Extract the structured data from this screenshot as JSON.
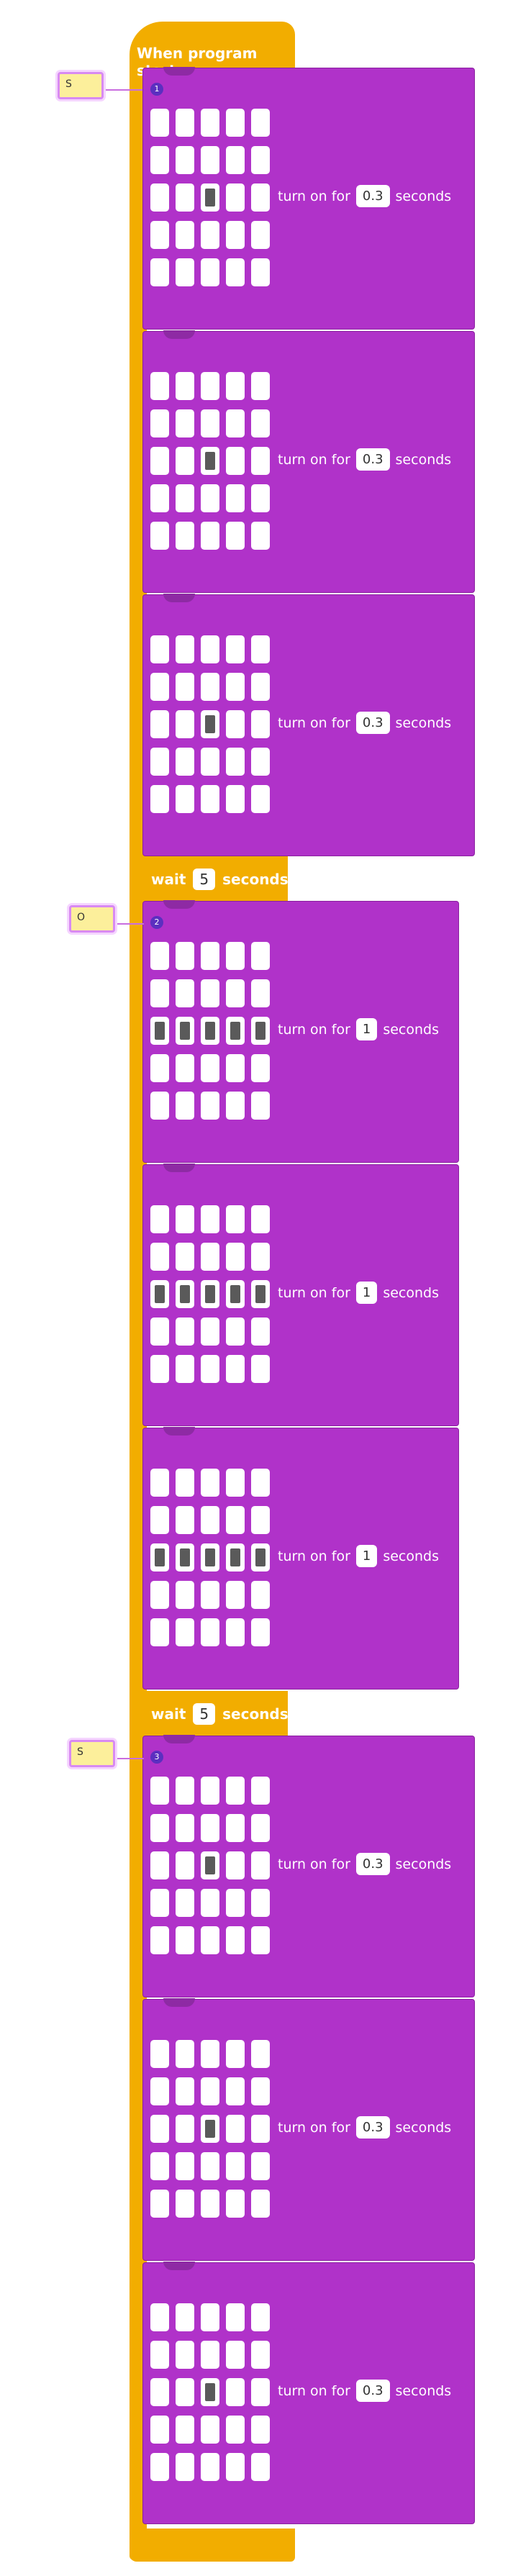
{
  "program": {
    "hat_label": "When program starts"
  },
  "comments": [
    "S",
    "O",
    "S"
  ],
  "wait_blocks": [
    {
      "label": "wait",
      "value": "5",
      "unit": "seconds"
    },
    {
      "label": "wait",
      "value": "5",
      "unit": "seconds"
    }
  ],
  "led_blocks": [
    {
      "label": "turn on for",
      "value": "0.3",
      "unit": "seconds",
      "pattern": "center"
    },
    {
      "label": "turn on for",
      "value": "0.3",
      "unit": "seconds",
      "pattern": "center"
    },
    {
      "label": "turn on for",
      "value": "0.3",
      "unit": "seconds",
      "pattern": "center"
    },
    {
      "label": "turn on for",
      "value": "1",
      "unit": "seconds",
      "pattern": "middle_row"
    },
    {
      "label": "turn on for",
      "value": "1",
      "unit": "seconds",
      "pattern": "middle_row"
    },
    {
      "label": "turn on for",
      "value": "1",
      "unit": "seconds",
      "pattern": "middle_row"
    },
    {
      "label": "turn on for",
      "value": "0.3",
      "unit": "seconds",
      "pattern": "center"
    },
    {
      "label": "turn on for",
      "value": "0.3",
      "unit": "seconds",
      "pattern": "center"
    },
    {
      "label": "turn on for",
      "value": "0.3",
      "unit": "seconds",
      "pattern": "center"
    }
  ],
  "colors": {
    "event_block": "#f2ad00",
    "led_block": "#b032c9",
    "comment_fill": "#fcef9b",
    "comment_border": "#d88af2"
  }
}
